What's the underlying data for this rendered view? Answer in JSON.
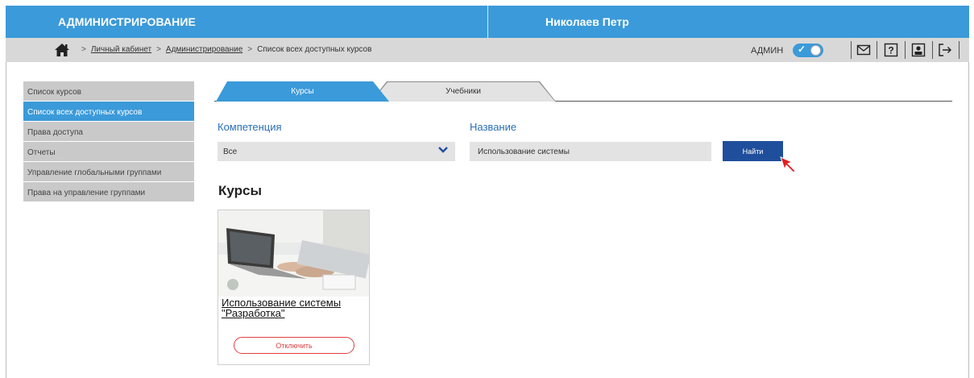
{
  "header": {
    "app_title": "АДМИНИСТРИРОВАНИЕ",
    "user_name": "Николаев Петр",
    "accent_color": "#3b9ad9"
  },
  "breadcrumb": {
    "home_icon": "home-icon",
    "items": [
      "Личный кабинет",
      "Администрирование",
      "Список всех доступных курсов"
    ],
    "separator": ">"
  },
  "toolbar": {
    "admin_label": "АДМИН",
    "admin_toggle_on": true,
    "icons": [
      "mail-icon",
      "help-icon",
      "profile-icon",
      "logout-icon"
    ]
  },
  "sidebar": {
    "items": [
      {
        "label": "Список курсов",
        "active": false
      },
      {
        "label": "Список всех доступных курсов",
        "active": true
      },
      {
        "label": "Права доступа",
        "active": false
      },
      {
        "label": "Отчеты",
        "active": false
      },
      {
        "label": "Управление глобальными группами",
        "active": false
      },
      {
        "label": "Права на управление группами",
        "active": false
      }
    ]
  },
  "tabs": [
    {
      "label": "Курсы",
      "active": true
    },
    {
      "label": "Учебники",
      "active": false
    }
  ],
  "filters": {
    "competence_label": "Компетенция",
    "competence_value": "Все",
    "name_label": "Название",
    "name_value": "Использование системы",
    "search_button": "Найти"
  },
  "courses_section": {
    "title": "Курсы",
    "cards": [
      {
        "title": "Использование системы \"Разработка\"",
        "button": "Отключить"
      }
    ]
  }
}
